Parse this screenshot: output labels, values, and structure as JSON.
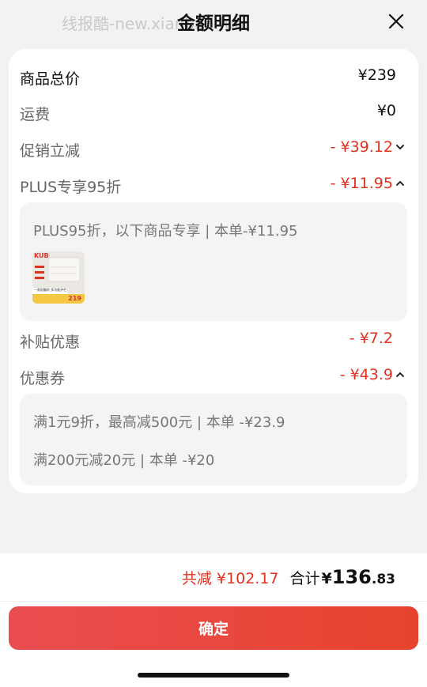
{
  "header": {
    "watermark": "线报酷-new.xianbao.fun",
    "title": "金额明细",
    "close_icon": "close-icon"
  },
  "breakdown": {
    "goods_total": {
      "label": "商品总价",
      "value": "¥239"
    },
    "shipping": {
      "label": "运费",
      "value": "¥0"
    },
    "promo": {
      "label": "促销立减",
      "value": "- ¥39.12",
      "icon": "chevron-down-icon"
    },
    "plus": {
      "label": "PLUS专享95折",
      "value": "- ¥11.95",
      "icon": "chevron-up-icon",
      "detail": "PLUS95折，以下商品专享 | 本单-¥11.95",
      "product_thumb": {
        "brand": "KUB",
        "caption": "一款耐翻的 多功能护栏",
        "price": "219"
      }
    },
    "subsidy": {
      "label": "补贴优惠",
      "value": "- ¥7.2"
    },
    "coupon": {
      "label": "优惠券",
      "value": "- ¥43.9",
      "icon": "chevron-up-icon",
      "details": [
        "满1元9折，最高减500元 | 本单 -¥23.9",
        "满200元减20元 | 本单 -¥20"
      ]
    }
  },
  "footer": {
    "total_reduce": "共减 ¥102.17",
    "sum_label": "合计",
    "sum_currency": "¥",
    "sum_int": "136",
    "sum_dec": ".83",
    "confirm_label": "确定"
  },
  "colors": {
    "accent_red": "#e0321e",
    "button_start": "#e94d50",
    "button_end": "#e8432d"
  }
}
